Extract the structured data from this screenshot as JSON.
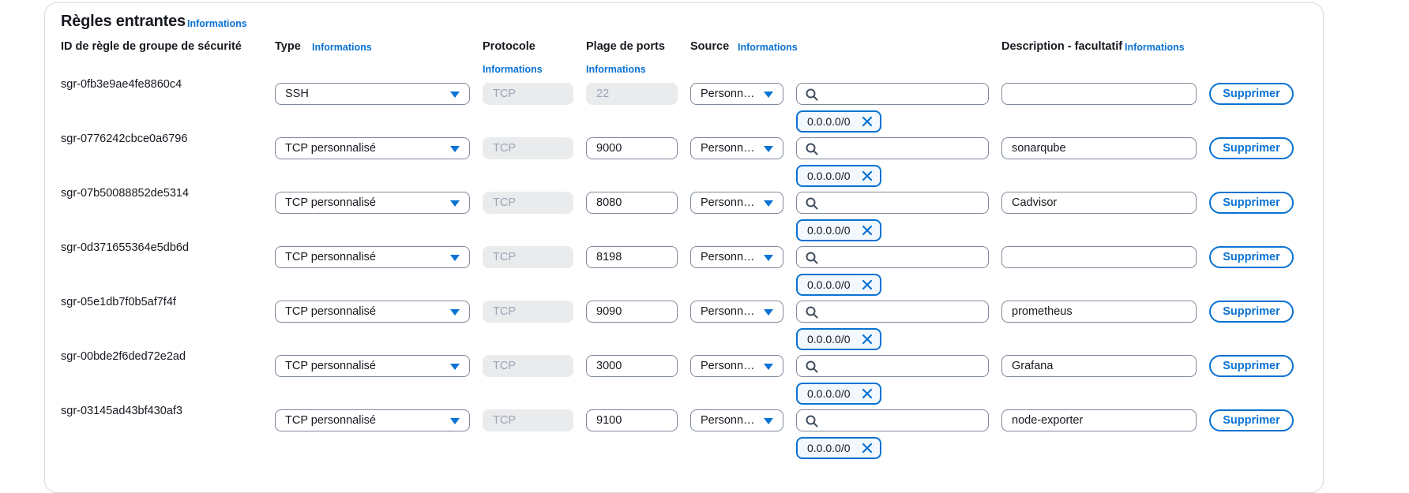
{
  "title": "Règles entrantes",
  "info_label": "Informations",
  "headers": {
    "rule_id": "ID de règle de groupe de sécurité",
    "type": "Type",
    "protocol": "Protocole",
    "port_range": "Plage de ports",
    "source": "Source",
    "description": "Description - facultatif"
  },
  "delete_label": "Supprimer",
  "source_value": "Personn…",
  "rules": [
    {
      "id": "sgr-0fb3e9ae4fe8860c4",
      "type": "SSH",
      "protocol": "TCP",
      "port": "22",
      "port_disabled": true,
      "description": "",
      "cidr": "0.0.0.0/0"
    },
    {
      "id": "sgr-0776242cbce0a6796",
      "type": "TCP personnalisé",
      "protocol": "TCP",
      "port": "9000",
      "port_disabled": false,
      "description": "sonarqube",
      "cidr": "0.0.0.0/0"
    },
    {
      "id": "sgr-07b50088852de5314",
      "type": "TCP personnalisé",
      "protocol": "TCP",
      "port": "8080",
      "port_disabled": false,
      "description": "Cadvisor",
      "cidr": "0.0.0.0/0"
    },
    {
      "id": "sgr-0d371655364e5db6d",
      "type": "TCP personnalisé",
      "protocol": "TCP",
      "port": "8198",
      "port_disabled": false,
      "description": "",
      "cidr": "0.0.0.0/0"
    },
    {
      "id": "sgr-05e1db7f0b5af7f4f",
      "type": "TCP personnalisé",
      "protocol": "TCP",
      "port": "9090",
      "port_disabled": false,
      "description": "prometheus",
      "cidr": "0.0.0.0/0"
    },
    {
      "id": "sgr-00bde2f6ded72e2ad",
      "type": "TCP personnalisé",
      "protocol": "TCP",
      "port": "3000",
      "port_disabled": false,
      "description": "Grafana",
      "cidr": "0.0.0.0/0"
    },
    {
      "id": "sgr-03145ad43bf430af3",
      "type": "TCP personnalisé",
      "protocol": "TCP",
      "port": "9100",
      "port_disabled": false,
      "description": "node-exporter",
      "cidr": "0.0.0.0/0"
    }
  ],
  "colors": {
    "link": "#0972d3",
    "text": "#16191f",
    "border": "#7d8998",
    "disabled_bg": "#e9ebed"
  },
  "icons": {
    "search": "search-icon",
    "dismiss": "close-icon",
    "caret": "caret-down-icon"
  }
}
